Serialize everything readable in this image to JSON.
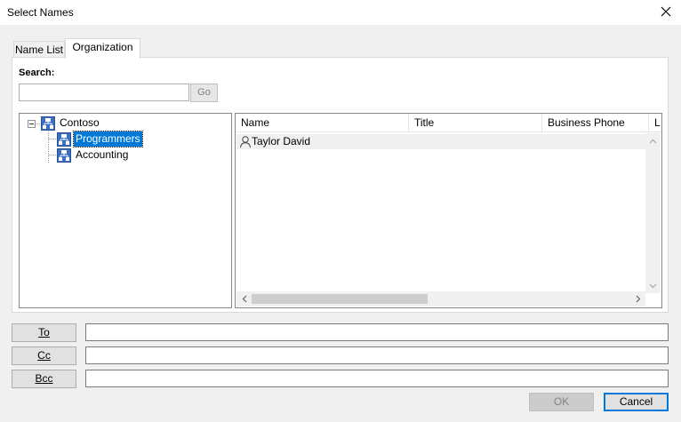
{
  "window": {
    "title": "Select Names"
  },
  "tabs": [
    {
      "label": "Name List"
    },
    {
      "label": "Organization"
    }
  ],
  "search": {
    "label": "Search:",
    "value": "",
    "go_label": "Go"
  },
  "tree": {
    "root": {
      "label": "Contoso"
    },
    "children": [
      {
        "label": "Programmers",
        "selected": true
      },
      {
        "label": "Accounting",
        "selected": false
      }
    ]
  },
  "list": {
    "columns": [
      "Name",
      "Title",
      "Business Phone",
      "L"
    ],
    "rows": [
      {
        "name": "Taylor David"
      }
    ]
  },
  "recipients": {
    "to_label": "To",
    "cc_label": "Cc",
    "bcc_label": "Bcc",
    "to_value": "",
    "cc_value": "",
    "bcc_value": ""
  },
  "buttons": {
    "ok": "OK",
    "cancel": "Cancel"
  },
  "colors": {
    "selection": "#0078d7",
    "accent": "#0078d7"
  }
}
